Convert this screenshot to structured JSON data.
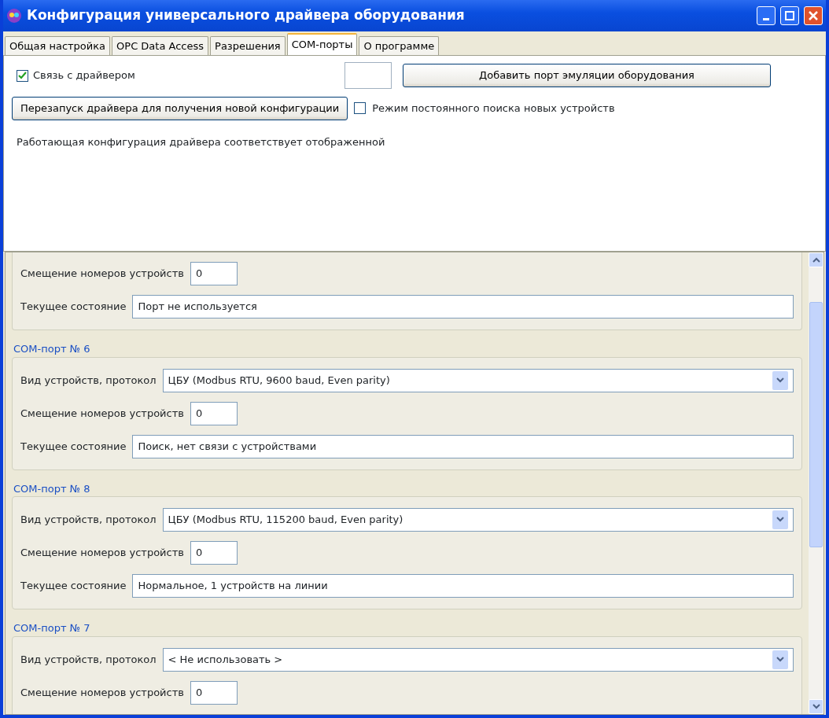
{
  "window": {
    "title": "Конфигурация универсального драйвера оборудования"
  },
  "tabs": [
    {
      "label": "Общая настройка",
      "selected": false
    },
    {
      "label": "OPC Data Access",
      "selected": false
    },
    {
      "label": "Разрешения",
      "selected": false
    },
    {
      "label": "COM-порты",
      "selected": true
    },
    {
      "label": "О программе",
      "selected": false
    }
  ],
  "driver_link": {
    "label": "Связь с драйвером",
    "checked": true
  },
  "add_port_button": "Добавить порт эмуляции оборудования",
  "restart_button": "Перезапуск драйвера для получения новой конфигурации",
  "continuous_search": {
    "label": "Режим постоянного поиска новых устройств",
    "checked": false
  },
  "status_message": "Работающая конфигурация драйвера соответствует отображенной",
  "ports": [
    {
      "fields": [
        {
          "kind": "input",
          "label": "Смещение номеров устройств",
          "value": "0"
        },
        {
          "kind": "status",
          "label": "Текущее состояние",
          "value": "Порт не используется"
        }
      ]
    },
    {
      "legend": "COM-порт № 6",
      "fields": [
        {
          "kind": "select",
          "label": "Вид устройств, протокол",
          "value": "ЦБУ (Modbus RTU, 9600 baud, Even parity)"
        },
        {
          "kind": "input",
          "label": "Смещение номеров устройств",
          "value": "0"
        },
        {
          "kind": "status",
          "label": "Текущее состояние",
          "value": "Поиск, нет связи с устройствами"
        }
      ]
    },
    {
      "legend": "COM-порт № 8",
      "fields": [
        {
          "kind": "select",
          "label": "Вид устройств, протокол",
          "value": "ЦБУ (Modbus RTU, 115200 baud, Even parity)"
        },
        {
          "kind": "input",
          "label": "Смещение номеров устройств",
          "value": "0"
        },
        {
          "kind": "status",
          "label": "Текущее состояние",
          "value": "Нормальное, 1 устройств на линии"
        }
      ]
    },
    {
      "legend": "COM-порт № 7",
      "fields": [
        {
          "kind": "select",
          "label": "Вид устройств, протокол",
          "value": "< Не использовать >"
        },
        {
          "kind": "input",
          "label": "Смещение номеров устройств",
          "value": "0"
        }
      ]
    }
  ]
}
